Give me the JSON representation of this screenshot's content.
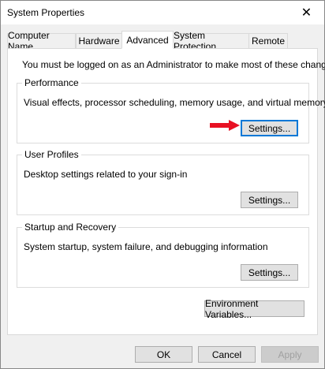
{
  "window": {
    "title": "System Properties"
  },
  "tabs": [
    {
      "label": "Computer Name"
    },
    {
      "label": "Hardware"
    },
    {
      "label": "Advanced"
    },
    {
      "label": "System Protection"
    },
    {
      "label": "Remote"
    }
  ],
  "admin_note": "You must be logged on as an Administrator to make most of these changes.",
  "performance": {
    "label": "Performance",
    "description": "Visual effects, processor scheduling, memory usage, and virtual memory",
    "button": "Settings..."
  },
  "user_profiles": {
    "label": "User Profiles",
    "description": "Desktop settings related to your sign-in",
    "button": "Settings..."
  },
  "startup_recovery": {
    "label": "Startup and Recovery",
    "description": "System startup, system failure, and debugging information",
    "button": "Settings..."
  },
  "environment_button": "Environment Variables...",
  "footer": {
    "ok": "OK",
    "cancel": "Cancel",
    "apply": "Apply"
  },
  "colors": {
    "focus": "#0078d7",
    "arrow": "#e81123"
  },
  "icons": {
    "close": "close-icon",
    "arrow": "red-arrow-icon"
  }
}
